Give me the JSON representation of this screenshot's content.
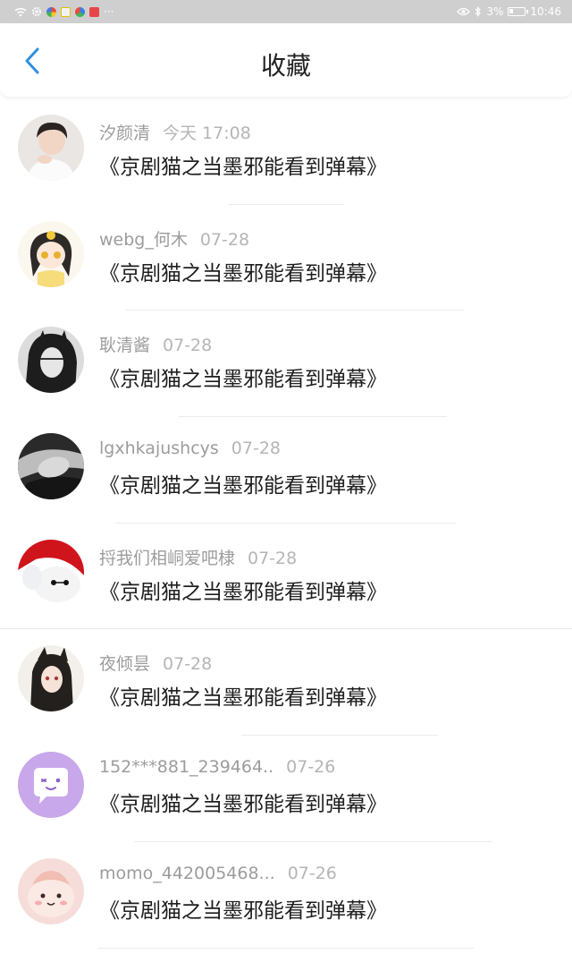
{
  "status_bar": {
    "battery": "3%",
    "time": "10:46",
    "more": "···"
  },
  "header": {
    "title": "收藏"
  },
  "items": [
    {
      "name": "汐颜清",
      "time": "今天 17:08",
      "content": "《京剧猫之当墨邪能看到弹幕》"
    },
    {
      "name": "webg_何木",
      "time": "07-28",
      "content": "《京剧猫之当墨邪能看到弹幕》"
    },
    {
      "name": "耿清酱",
      "time": "07-28",
      "content": "《京剧猫之当墨邪能看到弹幕》"
    },
    {
      "name": "lgxhkajushcys",
      "time": "07-28",
      "content": "《京剧猫之当墨邪能看到弹幕》"
    },
    {
      "name": "捋我们相峒爱吧棣",
      "time": "07-28",
      "content": "《京剧猫之当墨邪能看到弹幕》"
    },
    {
      "name": "夜倾昙",
      "time": "07-28",
      "content": "《京剧猫之当墨邪能看到弹幕》"
    },
    {
      "name": "152***881_239464..",
      "time": "07-26",
      "content": "《京剧猫之当墨邪能看到弹幕》"
    },
    {
      "name": "momo_442005468...",
      "time": "07-26",
      "content": "《京剧猫之当墨邪能看到弹幕》"
    }
  ],
  "colors": {
    "accent": "#2f8fe0",
    "status_bar": "#cfcfcf",
    "name_text": "#9c9c9c",
    "time_text": "#b5b5b5"
  }
}
